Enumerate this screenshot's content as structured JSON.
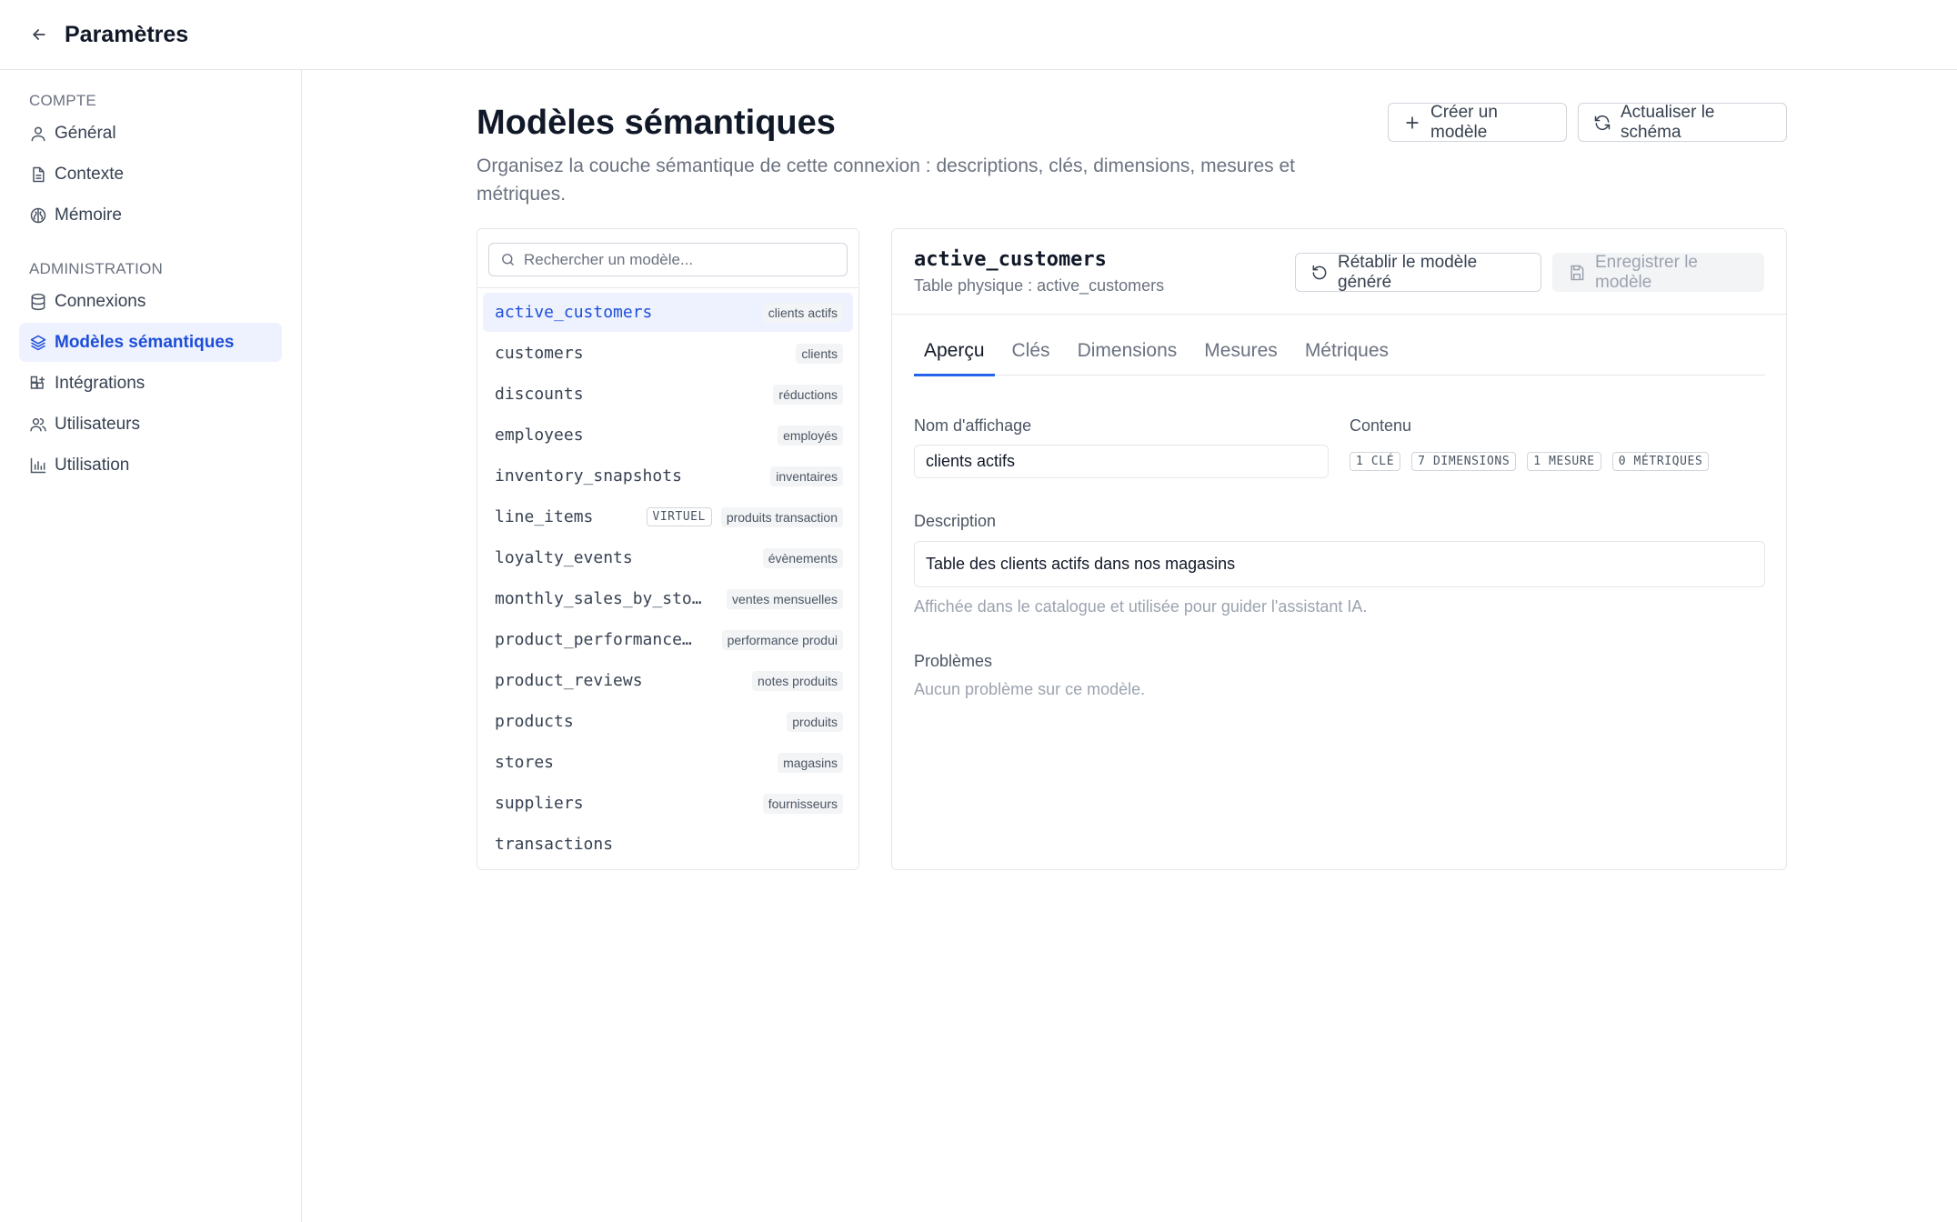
{
  "topbar": {
    "title": "Paramètres"
  },
  "sidebar": {
    "sections": [
      {
        "title": "COMPTE",
        "items": [
          {
            "label": "Général",
            "icon": "user-icon"
          },
          {
            "label": "Contexte",
            "icon": "document-icon"
          },
          {
            "label": "Mémoire",
            "icon": "brain-icon"
          }
        ]
      },
      {
        "title": "ADMINISTRATION",
        "items": [
          {
            "label": "Connexions",
            "icon": "database-icon"
          },
          {
            "label": "Modèles sémantiques",
            "icon": "layers-icon",
            "active": true
          },
          {
            "label": "Intégrations",
            "icon": "grid-plus-icon"
          },
          {
            "label": "Utilisateurs",
            "icon": "users-icon"
          },
          {
            "label": "Utilisation",
            "icon": "bar-chart-icon"
          }
        ]
      }
    ]
  },
  "main": {
    "title": "Modèles sémantiques",
    "description": "Organisez la couche sémantique de cette connexion : descriptions, clés, dimensions, mesures et métriques.",
    "create_label": "Créer un modèle",
    "refresh_label": "Actualiser le schéma"
  },
  "list": {
    "search_placeholder": "Rechercher un modèle...",
    "models": [
      {
        "name": "active_customers",
        "badge": "clients actifs",
        "active": true
      },
      {
        "name": "customers",
        "badge": "clients"
      },
      {
        "name": "discounts",
        "badge": "réductions"
      },
      {
        "name": "employees",
        "badge": "employés"
      },
      {
        "name": "inventory_snapshots",
        "badge": "inventaires"
      },
      {
        "name": "line_items",
        "tag": "VIRTUEL",
        "badge": "produits transaction"
      },
      {
        "name": "loyalty_events",
        "badge": "évènements"
      },
      {
        "name": "monthly_sales_by_sto…",
        "badge": "ventes mensuelles"
      },
      {
        "name": "product_performance…",
        "badge": "performance produi"
      },
      {
        "name": "product_reviews",
        "badge": "notes produits"
      },
      {
        "name": "products",
        "badge": "produits"
      },
      {
        "name": "stores",
        "badge": "magasins"
      },
      {
        "name": "suppliers",
        "badge": "fournisseurs"
      },
      {
        "name": "transactions",
        "badge": ""
      }
    ]
  },
  "detail": {
    "name": "active_customers",
    "physical_table": "Table physique : active_customers",
    "restore_label": "Rétablir le modèle généré",
    "save_label": "Enregistrer le modèle",
    "tabs": [
      "Aperçu",
      "Clés",
      "Dimensions",
      "Mesures",
      "Métriques"
    ],
    "active_tab": "Aperçu",
    "display_name_label": "Nom d'affichage",
    "display_name_value": "clients actifs",
    "content_label": "Contenu",
    "content_chips": [
      "1 CLÉ",
      "7 DIMENSIONS",
      "1 MESURE",
      "0 MÉTRIQUES"
    ],
    "description_label": "Description",
    "description_value": "Table des clients actifs dans nos magasins",
    "description_hint": "Affichée dans le catalogue et utilisée pour guider l'assistant IA.",
    "problems_label": "Problèmes",
    "problems_hint": "Aucun problème sur ce modèle."
  },
  "colors": {
    "accent": "#2563eb",
    "active_bg": "#eef2ff",
    "active_text": "#1d4ed8"
  }
}
